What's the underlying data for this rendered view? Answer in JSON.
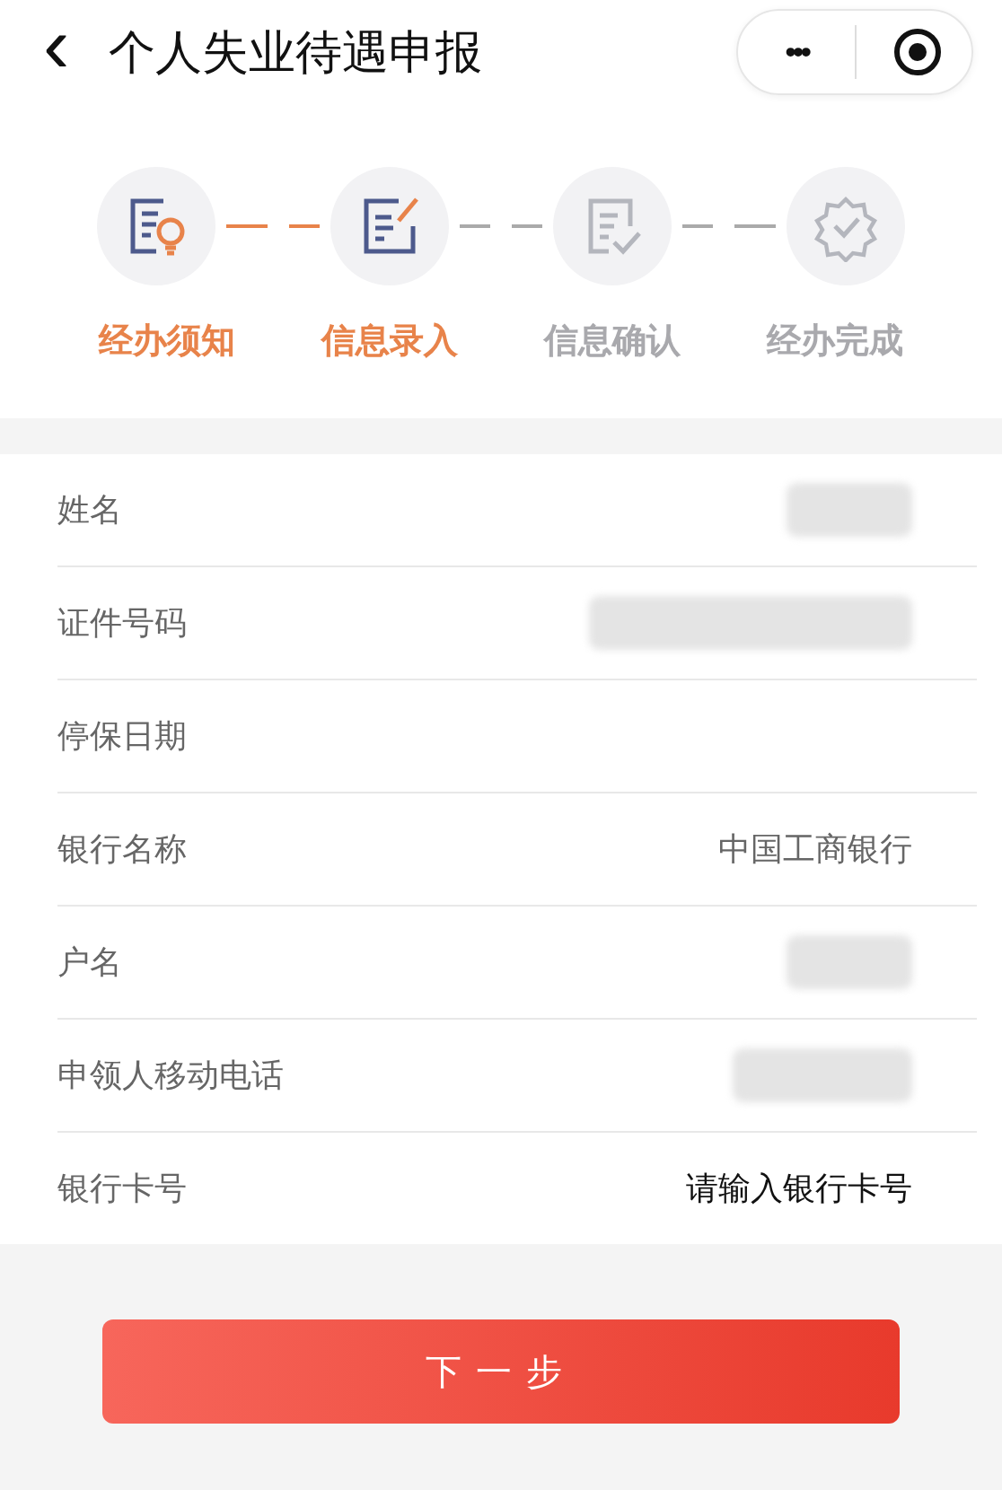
{
  "nav": {
    "back": "‹",
    "title": "个人失业待遇申报",
    "more": "•••"
  },
  "steps": [
    {
      "label": "经办须知",
      "done": true
    },
    {
      "label": "信息录入",
      "done": true
    },
    {
      "label": "信息确认",
      "done": false
    },
    {
      "label": "经办完成",
      "done": false
    }
  ],
  "fields": [
    {
      "label": "姓名",
      "kind": "masked"
    },
    {
      "label": "证件号码",
      "kind": "masked"
    },
    {
      "label": "停保日期",
      "kind": "empty"
    },
    {
      "label": "银行名称",
      "kind": "value",
      "value": "中国工商银行"
    },
    {
      "label": "户名",
      "kind": "masked"
    },
    {
      "label": "申领人移动电话",
      "kind": "masked"
    },
    {
      "label": "银行卡号",
      "kind": "input",
      "placeholder": "请输入银行卡号"
    }
  ],
  "next_button": "下一步"
}
